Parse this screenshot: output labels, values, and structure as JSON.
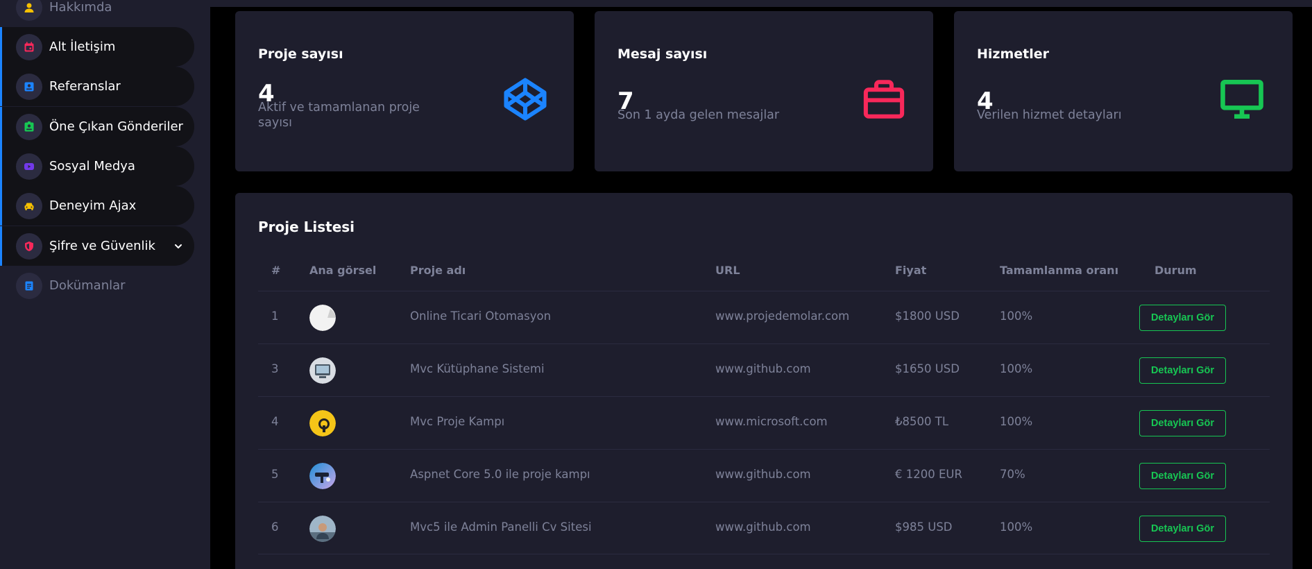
{
  "sidebar": {
    "items": [
      {
        "label": "Hakkımda",
        "icon": "user-icon",
        "color": "#f6c000"
      },
      {
        "label": "Alt İletişim",
        "icon": "calendar-icon",
        "color": "#f8285a"
      },
      {
        "label": "Referanslar",
        "icon": "contact-card-icon",
        "color": "#1b84ff"
      },
      {
        "label": "Öne Çıkan Gönderiler",
        "icon": "featured-badge-icon",
        "color": "#17c653"
      },
      {
        "label": "Sosyal Medya",
        "icon": "youtube-icon",
        "color": "#7239ea"
      },
      {
        "label": "Deneyim Ajax",
        "icon": "car-icon",
        "color": "#f6c000"
      },
      {
        "label": "Şifre ve Güvenlik",
        "icon": "shield-icon",
        "color": "#f8285a"
      },
      {
        "label": "Dokümanlar",
        "icon": "document-icon",
        "color": "#1b84ff"
      }
    ]
  },
  "stats": [
    {
      "title": "Proje sayısı",
      "value": "4",
      "description": "Aktif ve tamamlanan proje sayısı",
      "icon": "codepen-icon",
      "color": "#1b84ff"
    },
    {
      "title": "Mesaj sayısı",
      "value": "7",
      "description": "Son 1 ayda gelen mesajlar",
      "icon": "briefcase-icon",
      "color": "#f8285a"
    },
    {
      "title": "Hizmetler",
      "value": "4",
      "description": "Verilen hizmet detayları",
      "icon": "monitor-icon",
      "color": "#17c653"
    }
  ],
  "projects": {
    "title": "Proje Listesi",
    "columns": [
      "#",
      "Ana görsel",
      "Proje adı",
      "URL",
      "Fiyat",
      "Tamamlanma oranı",
      "Durum"
    ],
    "rows": [
      {
        "id": "1",
        "name": "Online Ticari Otomasyon",
        "url": "www.projedemolar.com",
        "price": "$1800 USD",
        "progress": "100%",
        "action": "Detayları Gör"
      },
      {
        "id": "3",
        "name": "Mvc Kütüphane Sistemi",
        "url": "www.github.com",
        "price": "$1650 USD",
        "progress": "100%",
        "action": "Detayları Gör"
      },
      {
        "id": "4",
        "name": "Mvc Proje Kampı",
        "url": "www.microsoft.com",
        "price": "₺8500 TL",
        "progress": "100%",
        "action": "Detayları Gör"
      },
      {
        "id": "5",
        "name": "Aspnet Core 5.0 ile proje kampı",
        "url": "www.github.com",
        "price": "€ 1200 EUR",
        "progress": "70%",
        "action": "Detayları Gör"
      },
      {
        "id": "6",
        "name": "Mvc5 ile Admin Panelli Cv Sitesi",
        "url": "www.github.com",
        "price": "$985 USD",
        "progress": "100%",
        "action": "Detayları Gör"
      }
    ]
  }
}
